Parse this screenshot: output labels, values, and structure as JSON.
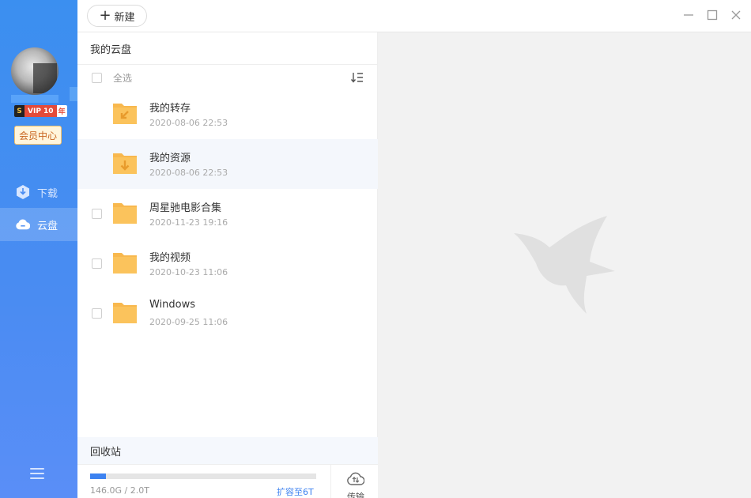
{
  "toolbar": {
    "new_label": "新建"
  },
  "sidebar": {
    "vip_s": "S",
    "vip_label": "VIP 10",
    "vip_year": "年",
    "member_center": "会员中心",
    "items": [
      {
        "label": "下载",
        "icon": "download-icon",
        "active": false
      },
      {
        "label": "云盘",
        "icon": "cloud-icon",
        "active": true
      }
    ]
  },
  "main": {
    "title": "我的云盘",
    "select_all": "全选",
    "files": [
      {
        "name": "我的转存",
        "date": "2020-08-06 22:53",
        "icon": "folder-transfer-icon"
      },
      {
        "name": "我的资源",
        "date": "2020-08-06 22:53",
        "icon": "folder-download-icon"
      },
      {
        "name": "周星驰电影合集",
        "date": "2020-11-23 19:16",
        "icon": "folder-icon"
      },
      {
        "name": "我的视频",
        "date": "2020-10-23 11:06",
        "icon": "folder-icon"
      },
      {
        "name": "Windows",
        "date": "2020-09-25 11:06",
        "icon": "folder-icon"
      }
    ],
    "recycle": "回收站",
    "storage": {
      "used_text": "146.0G / 2.0T",
      "used_fraction": 0.07,
      "expand": "扩容至6T"
    },
    "transfer_label": "传输"
  },
  "colors": {
    "accent": "#3d82f0",
    "sidebar": "#3b8ff0",
    "folder": "#f8b84e"
  }
}
